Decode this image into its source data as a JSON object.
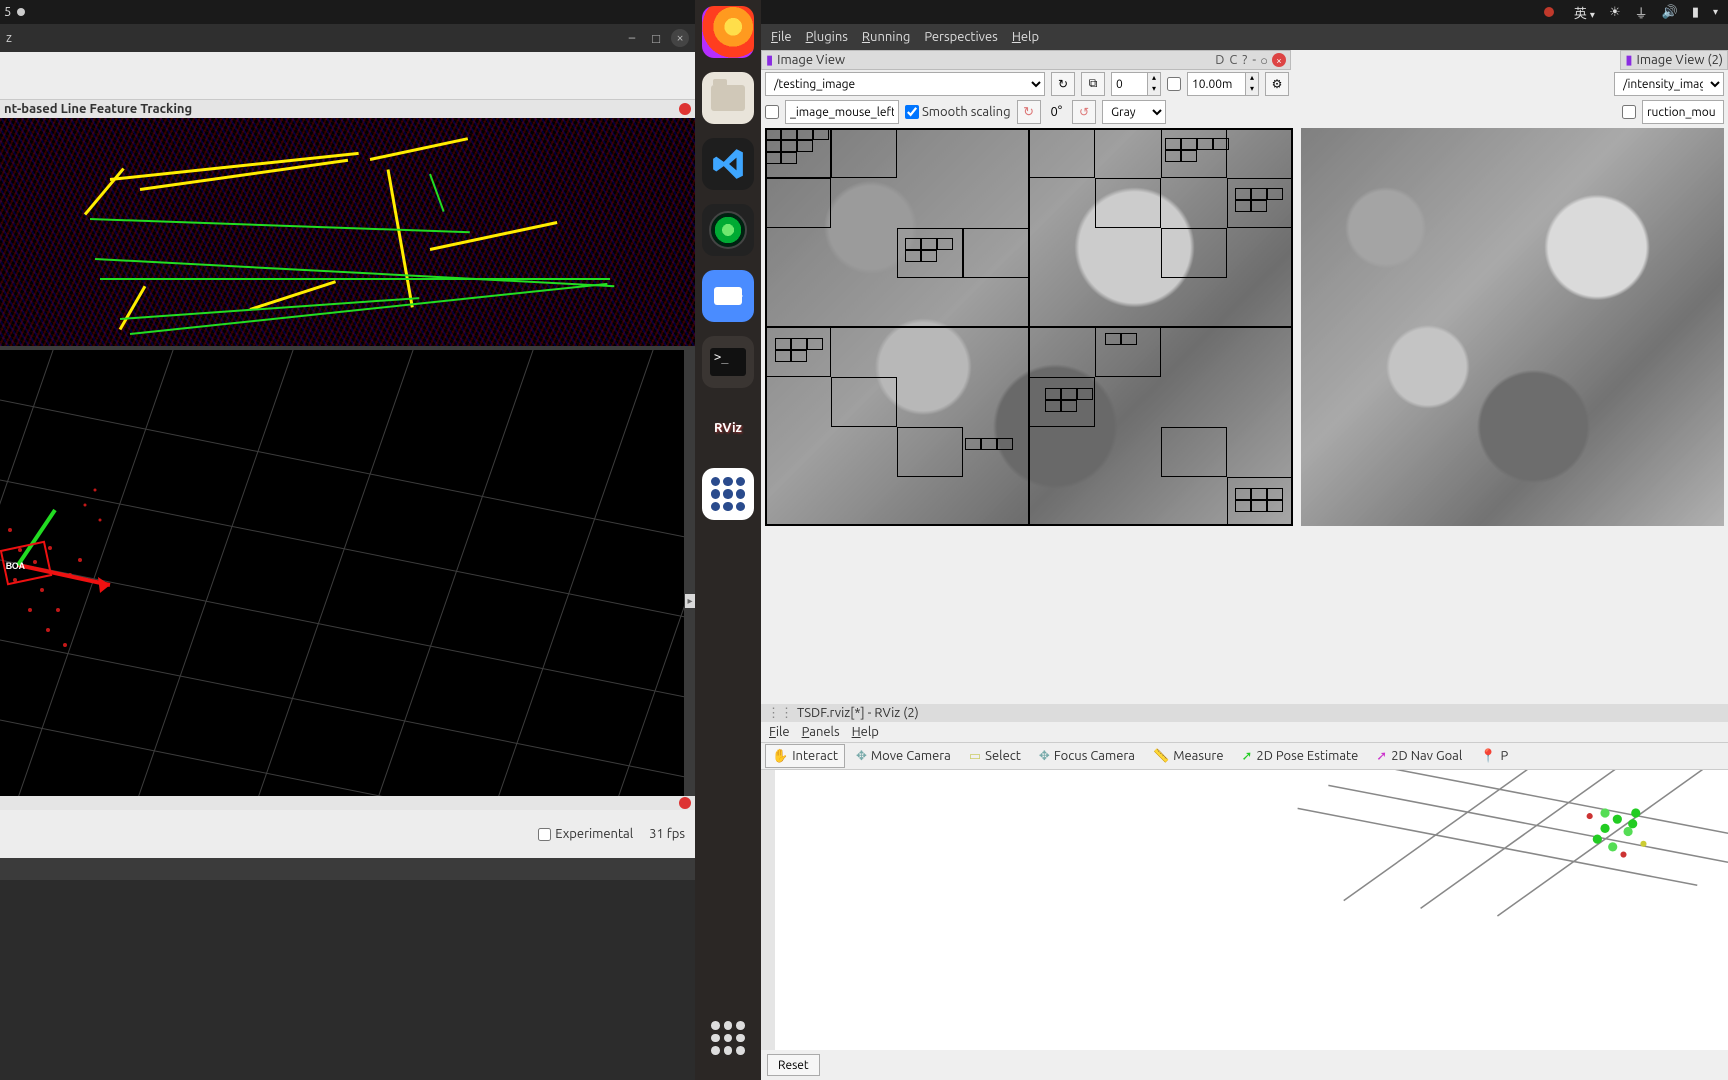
{
  "sysbar": {
    "left_text": "5",
    "ime": "英",
    "icons": [
      "brightness",
      "wifi",
      "volume",
      "battery"
    ]
  },
  "left_window": {
    "title": "z",
    "panel_title": "nt-based Line Feature Tracking",
    "experimental_label": "Experimental",
    "fps": "31 fps"
  },
  "dock": {
    "apps": [
      "firefox",
      "files",
      "vscode",
      "camera",
      "zoom",
      "terminal",
      "rviz",
      "grid-app",
      "show-apps"
    ],
    "rviz_label": "RViz"
  },
  "rqt": {
    "menu": {
      "file": "File",
      "plugins": "Plugins",
      "running": "Running",
      "perspectives": "Perspectives",
      "help": "Help"
    },
    "dock1": {
      "title": "Image View",
      "dco": "D C ?",
      "collapse": "-",
      "restore": "○"
    },
    "dock2": {
      "title": "Image View (2)"
    },
    "topic1": "/testing_image",
    "topic2": "/intensity_imag",
    "refresh": "↻",
    "save": "⧉",
    "num_topics": "0",
    "zoom": "10.00m",
    "gear": "⚙",
    "mouse_field1": "_image_mouse_left",
    "mouse_field2": "ruction_mou",
    "smooth_label": "Smooth scaling",
    "rotate_icon": "↻",
    "angle": "0°",
    "rot2": "↺",
    "colormap": "Gray"
  },
  "rviz2": {
    "title": "TSDF.rviz[*] - RViz (2)",
    "menu": {
      "file": "File",
      "panels": "Panels",
      "help": "Help"
    },
    "tools": {
      "interact": "Interact",
      "move": "Move Camera",
      "select": "Select",
      "focus": "Focus Camera",
      "measure": "Measure",
      "pose": "2D Pose Estimate",
      "nav": "2D Nav Goal",
      "point": "P"
    },
    "reset": "Reset"
  }
}
